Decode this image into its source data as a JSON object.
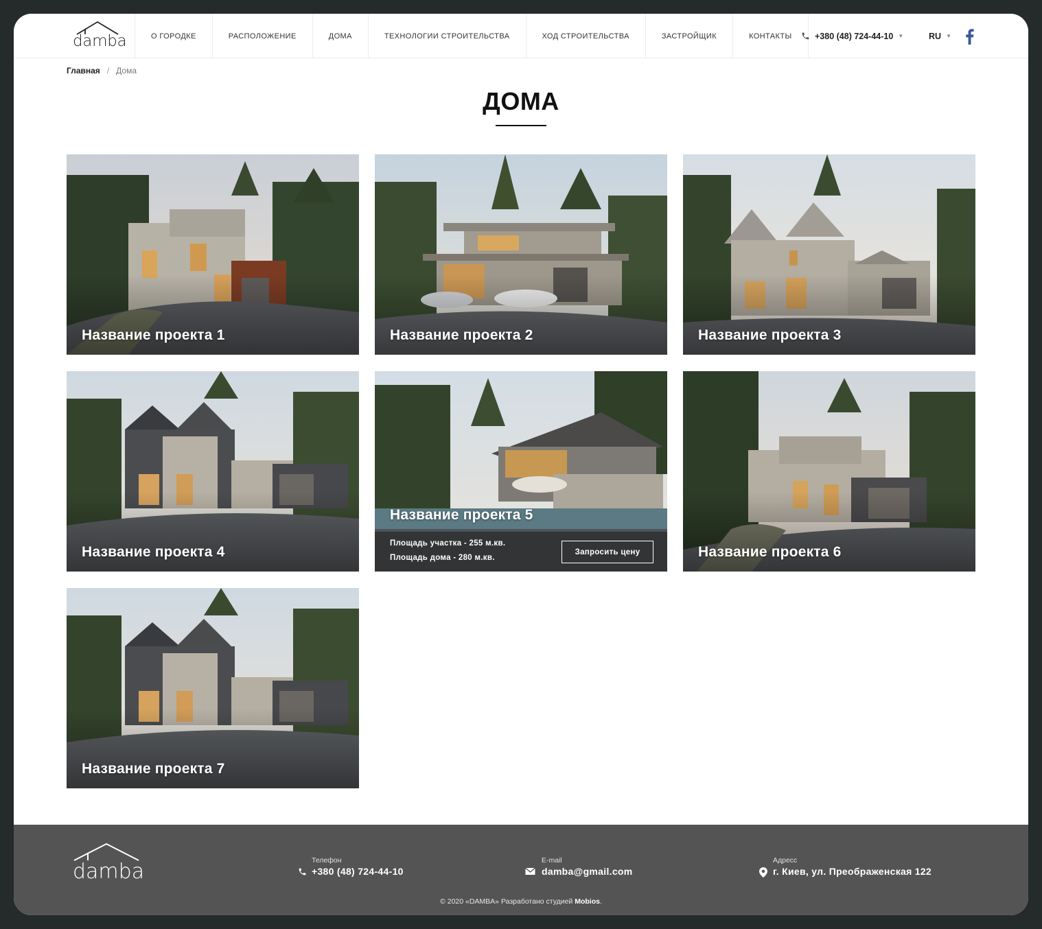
{
  "brand": {
    "name": "damba"
  },
  "nav": {
    "items": [
      {
        "label": "О городке"
      },
      {
        "label": "Расположение"
      },
      {
        "label": "Дома"
      },
      {
        "label": "Технологии строительства"
      },
      {
        "label": "Ход строительства"
      },
      {
        "label": "Застройщик"
      },
      {
        "label": "Контакты"
      }
    ],
    "phone": "+380 (48) 724-44-10",
    "lang": "RU"
  },
  "breadcrumb": {
    "home": "Главная",
    "separator": "/",
    "current": "Дома"
  },
  "page": {
    "title": "ДОМА"
  },
  "projects": [
    {
      "title": "Название проекта 1"
    },
    {
      "title": "Название проекта 2"
    },
    {
      "title": "Название проекта 3"
    },
    {
      "title": "Название проекта 4"
    },
    {
      "title": "Название проекта 5",
      "plot_area": "Площадь участка - 255 м.кв.",
      "house_area": "Площадь дома - 280 м.кв.",
      "button": "Запросить цену"
    },
    {
      "title": "Название проекта 6"
    },
    {
      "title": "Название проекта 7"
    }
  ],
  "footer": {
    "phone_label": "Телефон",
    "phone": "+380 (48) 724-44-10",
    "email_label": "E-mail",
    "email": "damba@gmail.com",
    "address_label": "Адресс",
    "address": "г. Киев, ул. Преображенская 122",
    "copyright_text": "© 2020 «DAMBA» Разработано студией",
    "studio": "Mobios",
    "copyright_end": "."
  },
  "colors": {
    "outer_frame": "#252a2a",
    "footer_bg": "#545454",
    "facebook": "#3b5998",
    "text_dark": "#111111"
  },
  "icons": [
    "phone-icon",
    "facebook-icon",
    "envelope-icon",
    "location-pin-icon",
    "house-roof-logo-icon"
  ]
}
